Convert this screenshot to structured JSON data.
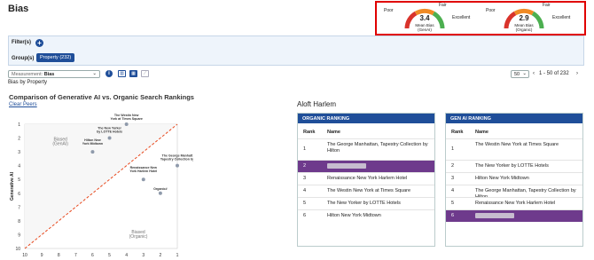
{
  "page": {
    "title": "Bias"
  },
  "gauges": [
    {
      "value": "3.4",
      "caption": "Mean Bias (GenAI)",
      "left_label": "Poor",
      "top_label": "Fair",
      "right_label": "Excellent"
    },
    {
      "value": "2.9",
      "caption": "Mean Bias (Organic)",
      "left_label": "Poor",
      "top_label": "Fair",
      "right_label": "Excellent"
    }
  ],
  "filters": {
    "label": "Filter(s)",
    "group_label": "Group(s)",
    "group_button": "Property (232)"
  },
  "toolbar": {
    "measurement_label": "Measurement:",
    "measurement_value": "Bias",
    "sub_label": "Bias by Property",
    "page_size": "50",
    "pagination_text": "1 - 50 of 232"
  },
  "colors": {
    "accent": "#1f4e99",
    "highlight": "#6e3a8c",
    "gauge_red": "#d9332b",
    "gauge_orange": "#f08a24",
    "gauge_green": "#4caf50",
    "diag": "#e84a1f"
  },
  "chart_data": {
    "type": "scatter",
    "title": "Comparison of Generative AI vs. Organic Search Rankings",
    "xlabel": "Organic Search Rank",
    "ylabel": "Generative AI",
    "xlim": [
      10,
      1
    ],
    "ylim": [
      1,
      10
    ],
    "xticks": [
      "10",
      "9",
      "8",
      "7",
      "6",
      "5",
      "4",
      "3",
      "2",
      "1"
    ],
    "yticks": [
      "1",
      "2",
      "3",
      "4",
      "5",
      "6",
      "7",
      "8",
      "9",
      "10"
    ],
    "annotations": [
      "Biased (GenAI)",
      "Biased (Organic)"
    ],
    "series": [
      {
        "points": [
          {
            "label": "The Westin New York at Times Square",
            "x": 4,
            "y": 1
          },
          {
            "label": "The New Yorker by LOTTE Hotels",
            "x": 5,
            "y": 2
          },
          {
            "label": "Hilton New York Midtown",
            "x": 6,
            "y": 3
          },
          {
            "label": "The George Manhattan, Tapestry Collection by Hilton",
            "x": 1,
            "y": 4
          },
          {
            "label": "Renaissance New York Harlem Hotel",
            "x": 3,
            "y": 5
          },
          {
            "label": "Organic#",
            "x": 2,
            "y": 6
          }
        ]
      }
    ]
  },
  "clear_peers": "Clear Peers",
  "selected_property": "Aloft Harlem",
  "organic": {
    "title": "ORGANIC RANKING",
    "col_rank": "Rank",
    "col_name": "Name",
    "rows": [
      {
        "rank": "1",
        "name": "The George Manhattan, Tapestry Collection by Hilton"
      },
      {
        "rank": "2",
        "name": ""
      },
      {
        "rank": "3",
        "name": "Renaissance New York Harlem Hotel"
      },
      {
        "rank": "4",
        "name": "The Westin New York at Times Square"
      },
      {
        "rank": "5",
        "name": "The New Yorker by LOTTE Hotels"
      },
      {
        "rank": "6",
        "name": "Hilton New York Midtown"
      }
    ]
  },
  "genai": {
    "title": "GEN AI RANKING",
    "col_rank": "Rank",
    "col_name": "Name",
    "rows": [
      {
        "rank": "1",
        "name": "The Westin New York at Times Square"
      },
      {
        "rank": "2",
        "name": "The New Yorker by LOTTE Hotels"
      },
      {
        "rank": "3",
        "name": "Hilton New York Midtown"
      },
      {
        "rank": "4",
        "name": "The George Manhattan, Tapestry Collection by Hilton"
      },
      {
        "rank": "5",
        "name": "Renaissance New York Harlem Hotel"
      },
      {
        "rank": "6",
        "name": ""
      }
    ]
  }
}
